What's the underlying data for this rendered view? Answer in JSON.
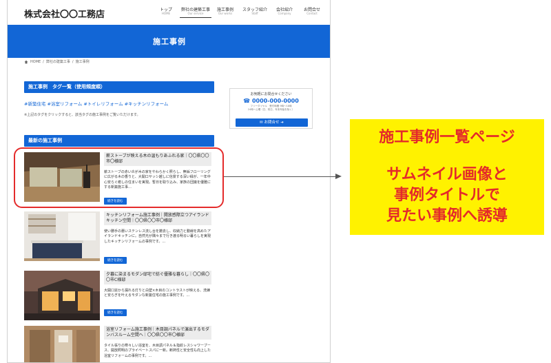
{
  "site": {
    "title": "株式会社〇〇工務店"
  },
  "nav": [
    {
      "label": "トップ",
      "sub": "HOME"
    },
    {
      "label": "弊社の建築工事",
      "sub": "Our service"
    },
    {
      "label": "施工事例",
      "sub": "Our works"
    },
    {
      "label": "スタッフ紹介",
      "sub": "Staff"
    },
    {
      "label": "会社紹介",
      "sub": "Company"
    },
    {
      "label": "お問合せ",
      "sub": "Contact"
    }
  ],
  "banner": {
    "title": "施工事例"
  },
  "breadcrumb": [
    "HOME",
    "/",
    "弊社の建築工事",
    "/",
    "施工事例"
  ],
  "tag_section": {
    "heading": "施工事例　タグ一覧（使用頻度順）",
    "tags": "#新築住宅 #浴室リフォーム #トイレリフォーム #キッチンリフォーム",
    "note": "※上記のタグをクリックすると、該当タグの施工事例をご覧いただけます。"
  },
  "latest": {
    "heading": "最新の施工事例",
    "more_label": "続きを読む",
    "posts": [
      {
        "title": "薪ストーブが映える木の温もりあふれる家｜〇〇県〇〇市〇様邸",
        "excerpt": "薪ストーブの赤い炎が木の家をやわらかく照らし、無垢フローリングに広がる木の香りと、大開口サッシ越しに信景する深い緑が、一年中心安らぐ癒しの住まいを実現。暫日を取り込み、家族の団欒を優雅にする新築施工事…"
      },
      {
        "title": "キッチンリフォーム施工事例｜開放感際立つアイランドキッチン空間｜〇〇県〇〇市〇様邸",
        "excerpt": "使い勝手の悪いステンレス流し台を撤去し、収納力と動線を高めたアイランドキッチンに。自然光が隅々まで行き渡る明るい暮らしを実現したキッチンリフォームの事例です。…"
      },
      {
        "title": "夕暮に染まるモダン邸宅で紡ぐ優雅な暮らし｜〇〇県〇〇市C様邸",
        "excerpt": "大開口窓から漏れる灯りと白壁×木目のコントラストが映える、洗練と安らぎを叶えるモダンな新築住宅の施工事例です。…"
      },
      {
        "title": "浴室リフォーム施工事例｜木目調パネルで演出するモダンバスルーム空間へ｜〇〇県〇〇市〇様邸",
        "excerpt": "タイル張りの寒々しい浴室を、木目調パネル＆指紋レスシャワーブース、開放照明のプライベートスパに一新。断熱性と安全性も向上した浴室リフォームの事例です。…"
      }
    ]
  },
  "sidebar": {
    "lead": "お気軽にお問合せください",
    "phone": "0000-000-0000",
    "hours": "フリーダイヤル　受付時間 9時〜18時\n24時〜土曜（日、祝日、年末年始を除く）",
    "button": "お問合せ"
  },
  "callout": {
    "line1": "施工事例一覧ページ",
    "line2": "サムネイル画像と",
    "line3": "事例タイトルで",
    "line4": "見たい事例へ誘導"
  },
  "colors": {
    "brand": "#1266d6",
    "accent_red": "#e42a2a",
    "callout_bg": "#fff200"
  }
}
